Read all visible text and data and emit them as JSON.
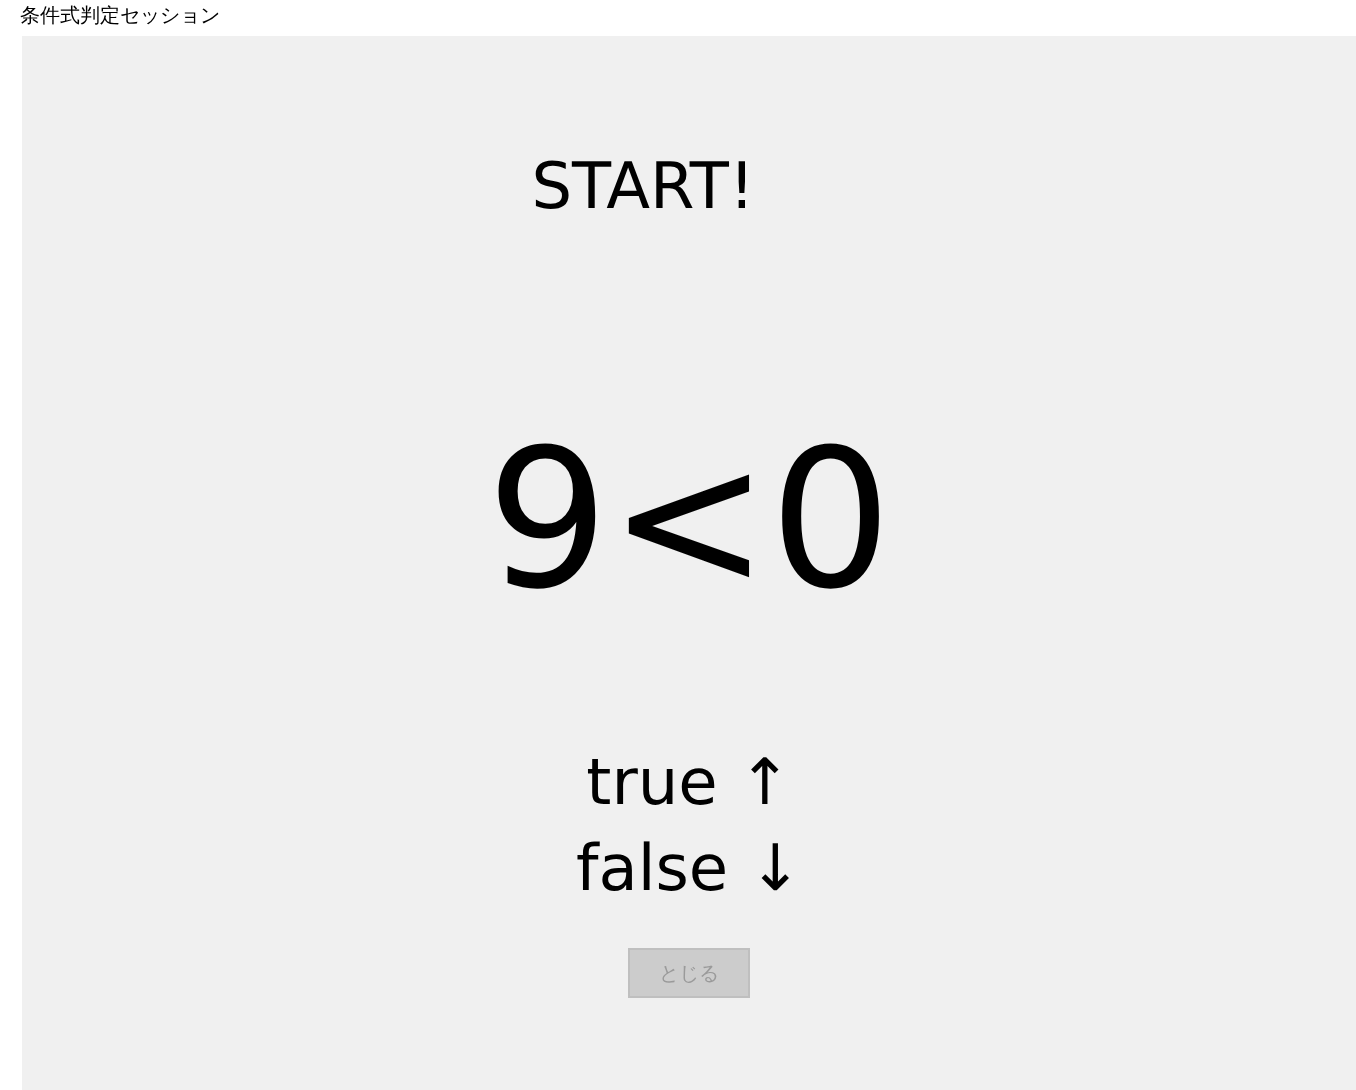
{
  "window": {
    "title": "条件式判定セッション"
  },
  "status": "START!",
  "expression": "9<0",
  "answers": [
    {
      "label": "true",
      "arrow": "↑"
    },
    {
      "label": "false",
      "arrow": "↓"
    }
  ],
  "close_button": {
    "label": "とじる",
    "disabled": true
  }
}
